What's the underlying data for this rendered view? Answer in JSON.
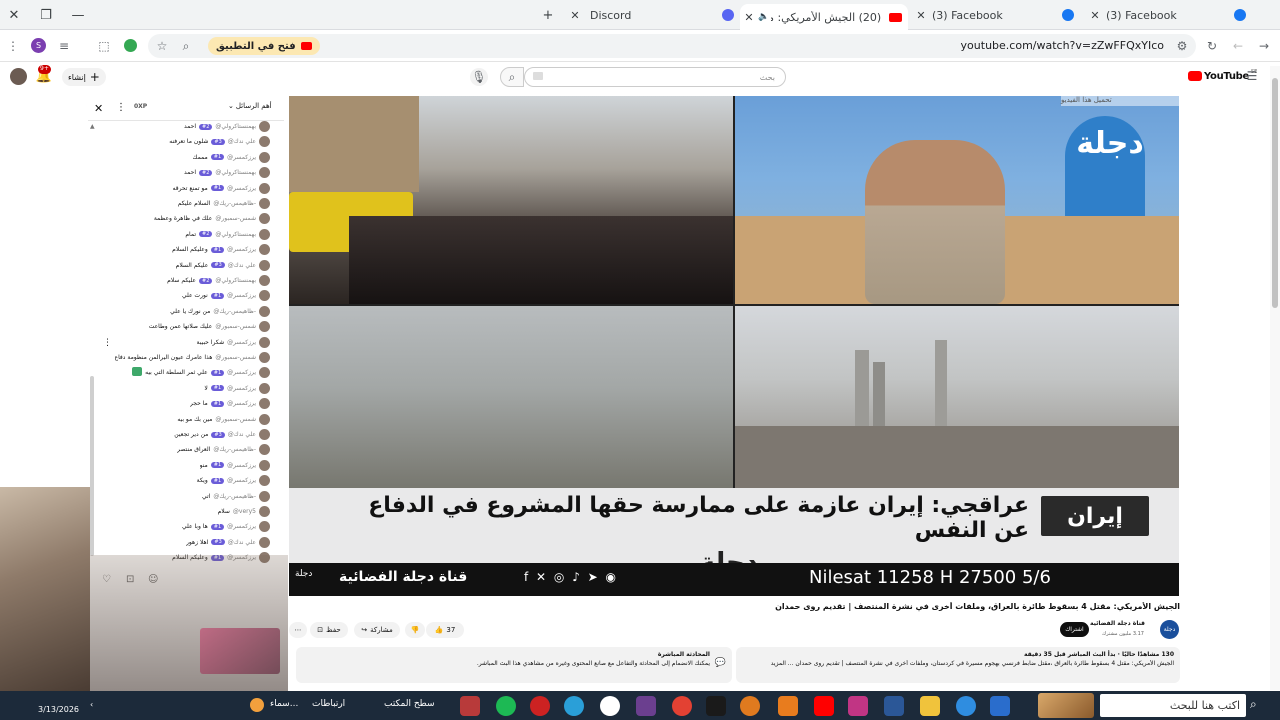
{
  "tabs": [
    {
      "title": "Discord",
      "icon": "discord-icon"
    },
    {
      "title": "(20) الجيش الأمريكي: مقتل",
      "icon": "youtube-icon"
    },
    {
      "title": "(3) Facebook",
      "icon": "facebook-icon"
    },
    {
      "title": "(3) Facebook",
      "icon": "facebook-icon"
    }
  ],
  "address": {
    "url": "youtube.com/watch?v=zZwFFQxYIco",
    "open_in_app": "فتح في التطبيق"
  },
  "youtube": {
    "logo": "YouTube",
    "logo_sup": "SE",
    "search_placeholder": "بحث",
    "create": "إنشاء",
    "notifications": "9+"
  },
  "chat": {
    "header": "أهم الرسائل",
    "points": "0XP",
    "rows": [
      {
        "name": "@بهمنستاكرولي",
        "badge": "#2",
        "msg": "احمد"
      },
      {
        "name": "@علي ندك",
        "badge": "#3",
        "msg": "شلون ما تعرفنه"
      },
      {
        "name": "@يرزكمسر",
        "badge": "#1",
        "msg": "مممك"
      },
      {
        "name": "@بهمنستاكرولي",
        "badge": "#2",
        "msg": "احمد"
      },
      {
        "name": "@يرزكمسر",
        "badge": "#1",
        "msg": "مو تمنع تحرقه"
      },
      {
        "name": "@ظاهيمس-ريك-",
        "badge": "",
        "msg": "السلام عليكم"
      },
      {
        "name": "@شمس-سمبور",
        "badge": "",
        "msg": "علك في ظاهرة وعظمة"
      },
      {
        "name": "@بهمنستاكرولي",
        "badge": "#2",
        "msg": "تمام"
      },
      {
        "name": "@يرزكمسر",
        "badge": "#1",
        "msg": "وعليكم السلام"
      },
      {
        "name": "@علي ندك",
        "badge": "#3",
        "msg": "عليكم السلام"
      },
      {
        "name": "@بهمنستاكرولي",
        "badge": "#2",
        "msg": "عليكم سلام"
      },
      {
        "name": "@يرزكمسر",
        "badge": "#1",
        "msg": "نورت علي"
      },
      {
        "name": "@ظاهيمس-ريك-",
        "badge": "",
        "msg": "من نورك يا علي"
      },
      {
        "name": "@شمس-سمبور",
        "badge": "",
        "msg": "عليك صلاتها عمن وطاعت"
      },
      {
        "name": "@يرزكمسر",
        "badge": "",
        "msg": "شكرا حبيبة"
      },
      {
        "name": "@شمس-سمبور",
        "badge": "",
        "msg": "هذا عامرك عيون اليرالمن منظومة دفاع"
      },
      {
        "name": "@يرزكمسر",
        "badge": "#1",
        "msg": "علي ثمر السلطة التي بيه"
      },
      {
        "name": "@يرزكمسر",
        "badge": "#1",
        "msg": "لا"
      },
      {
        "name": "@يرزكمسر",
        "badge": "#1",
        "msg": "ما حجر"
      },
      {
        "name": "@شمس-سمبور",
        "badge": "",
        "msg": "مين بك مو بيه"
      },
      {
        "name": "@علي ندك",
        "badge": "#3",
        "msg": "من دير تجعين"
      },
      {
        "name": "@ظاهيمس-ريك-",
        "badge": "",
        "msg": "العراق منتصر"
      },
      {
        "name": "@يرزكمسر",
        "badge": "#1",
        "msg": "منو"
      },
      {
        "name": "@يرزكمسر",
        "badge": "#1",
        "msg": "ويكة"
      },
      {
        "name": "@ظاهيمس-ريك-",
        "badge": "",
        "msg": "اتي"
      },
      {
        "name": "@very5",
        "badge": "",
        "msg": "سلام"
      },
      {
        "name": "@يرزكمسر",
        "badge": "#1",
        "msg": "ها وبا علي"
      },
      {
        "name": "@علي ندك",
        "badge": "#3",
        "msg": "اهلا زهور"
      },
      {
        "name": "@يرزكمسر",
        "badge": "#1",
        "msg": "وعليكم السلام"
      }
    ]
  },
  "video": {
    "channel_logo": "دجلة",
    "tag": "إيران",
    "headline": "عراقجي: إيران عازمة على ممارسة حقها المشروع في الدفاع عن النفس",
    "ticker_freq": "Nilesat  11258 H 27500 5/6",
    "ticker_channel": "قناة دجلة الفضائية",
    "corner_logo": "دجلة",
    "promo": "تحميل هذا الفيديو"
  },
  "below": {
    "title": "الجيش الأمريكي: مقتل 4 بسقوط طائرة بالعراق، وملفات أخرى في نشرة المنتصف | تقديم روى حمدان",
    "channel": "قناة دجلة الفضائية",
    "subs": "3.17 مليون مشترك",
    "subscribe": "اشتراك",
    "likes": "37",
    "share": "مشاركة",
    "save": "حفظ",
    "views_line": "130 مشاهدًا حاليًا · بدأ البث المباشر قبل 35 دقيقة",
    "desc_line": "الجيش الأمريكي: مقتل 4 بسقوط طائرة بالعراق ،مقتل ضابط فرنسي بهجوم مسيرة في كردستان، وملفات أخرى في نشرة المنتصف | تقديم روى حمدان ... المزيد",
    "replay_title": "المحادثة المباشرة",
    "replay_line": "يمكنك الانضمام إلى المحادثة والتفاعل مع صانع المحتوى وغيره من مشاهدي هذا البث المباشر."
  },
  "taskbar": {
    "search": "اكتب هنا للبحث",
    "date": "3/13/2026",
    "desktop": "سطح المكتب",
    "links": "ارتباطات",
    "weather": "سماء..."
  },
  "colors": {
    "youtube_red": "#ff0000",
    "chat_badge": "#6a5cd8",
    "taskbar": "#1c2a3a"
  }
}
